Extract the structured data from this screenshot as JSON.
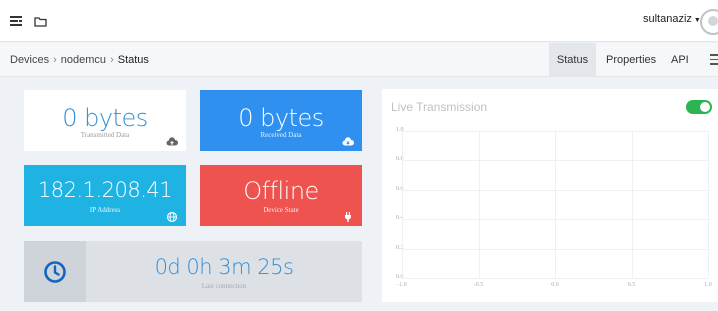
{
  "topbar": {
    "hamburger_icon": "list-menu-icon",
    "folder_icon": "folder-icon",
    "username": "sultanaziz"
  },
  "breadcrumb": {
    "items": [
      "Devices",
      "nodemcu",
      "Status"
    ]
  },
  "tabs": [
    {
      "label": "Status",
      "active": true
    },
    {
      "label": "Properties",
      "active": false
    },
    {
      "label": "API",
      "active": false
    }
  ],
  "tiles": {
    "transmitted": {
      "value": "0 bytes",
      "label": "Transmitted Data",
      "icon": "cloud-upload-icon"
    },
    "received": {
      "value": "0 bytes",
      "label": "Received Data",
      "icon": "cloud-download-icon",
      "color": "#2f90f0"
    },
    "ip": {
      "value": "182.1.208.41",
      "label": "IP Address",
      "icon": "globe-icon",
      "color": "#1fb3e4"
    },
    "state": {
      "value": "Offline",
      "label": "Device State",
      "icon": "plug-icon",
      "color": "#ef5350"
    },
    "connection": {
      "value": "0d 0h 3m 25s",
      "label": "Last connection",
      "icon": "clock-icon"
    }
  },
  "chart_data": {
    "type": "line",
    "title": "Live Transmission",
    "toggle_on": true,
    "toggle_color": "#2ab452",
    "xlim": [
      -1.0,
      1.0
    ],
    "ylim": [
      0.0,
      1.0
    ],
    "x_ticks": [
      "-1.0",
      "-0.5",
      "0.0",
      "0.5",
      "1.0"
    ],
    "y_ticks": [
      "1.0",
      "0.8",
      "0.6",
      "0.4",
      "0.2",
      "0.0"
    ],
    "series": []
  }
}
